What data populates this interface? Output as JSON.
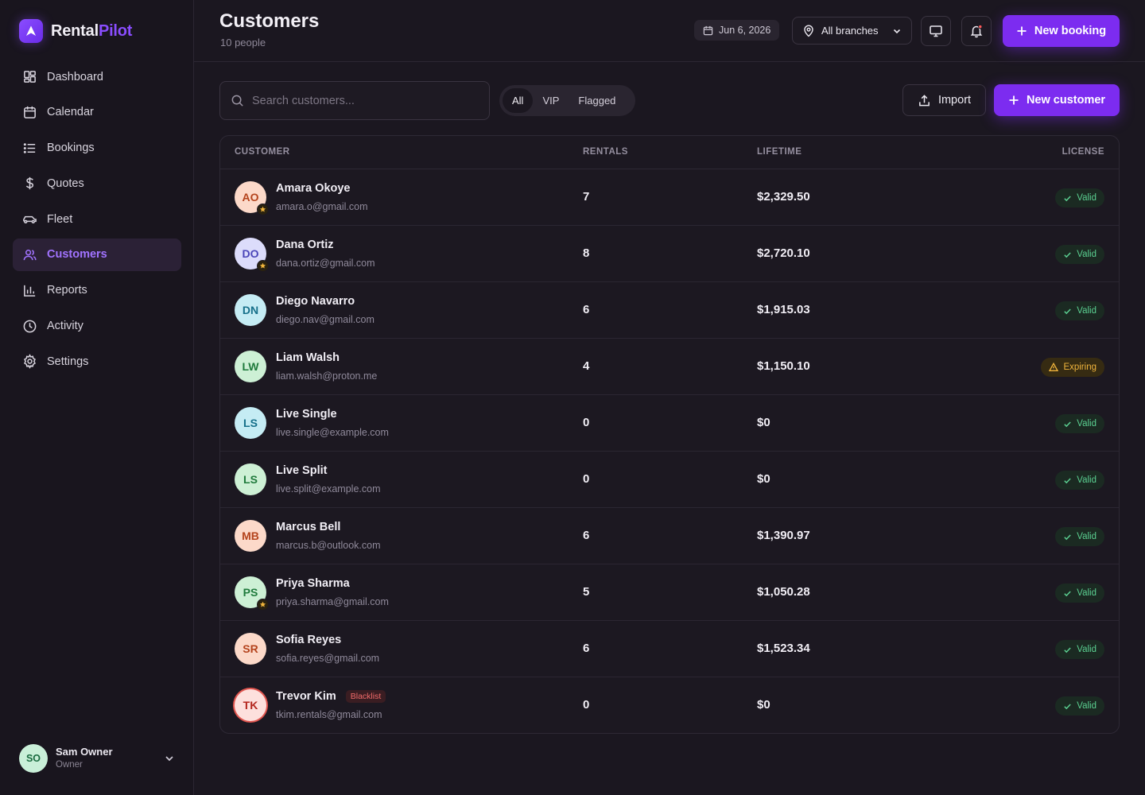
{
  "brand": {
    "name_a": "Rental",
    "name_b": "Pilot"
  },
  "sidebar": {
    "items": [
      {
        "key": "dashboard",
        "label": "Dashboard",
        "icon": "dashboard-icon"
      },
      {
        "key": "calendar",
        "label": "Calendar",
        "icon": "calendar-icon"
      },
      {
        "key": "bookings",
        "label": "Bookings",
        "icon": "list-icon"
      },
      {
        "key": "quotes",
        "label": "Quotes",
        "icon": "dollar-icon"
      },
      {
        "key": "fleet",
        "label": "Fleet",
        "icon": "car-icon"
      },
      {
        "key": "customers",
        "label": "Customers",
        "icon": "users-icon",
        "active": true
      },
      {
        "key": "reports",
        "label": "Reports",
        "icon": "bar-chart-icon"
      },
      {
        "key": "activity",
        "label": "Activity",
        "icon": "clock-icon"
      },
      {
        "key": "settings",
        "label": "Settings",
        "icon": "gear-icon"
      }
    ]
  },
  "user": {
    "initials": "SO",
    "name": "Sam Owner",
    "role": "Owner"
  },
  "header": {
    "title": "Customers",
    "subtitle": "10 people",
    "date": "Jun 6, 2026",
    "branch": "All branches",
    "new_booking": "New booking"
  },
  "toolbar": {
    "search_placeholder": "Search customers...",
    "filters": [
      "All",
      "VIP",
      "Flagged"
    ],
    "active_filter": "All",
    "import": "Import",
    "new_customer": "New customer"
  },
  "table": {
    "headers": {
      "customer": "CUSTOMER",
      "rentals": "RENTALS",
      "lifetime": "LIFETIME",
      "license": "LICENSE"
    },
    "rows": [
      {
        "initials": "AO",
        "name": "Amara Okoye",
        "email": "amara.o@gmail.com",
        "rentals": "7",
        "lifetime": "$2,329.50",
        "license": "Valid",
        "status": "valid",
        "vip": true,
        "avatar_bg": "#fcd9c9",
        "avatar_fg": "#b4431c"
      },
      {
        "initials": "DO",
        "name": "Dana Ortiz",
        "email": "dana.ortiz@gmail.com",
        "rentals": "8",
        "lifetime": "$2,720.10",
        "license": "Valid",
        "status": "valid",
        "vip": true,
        "avatar_bg": "#dcdcfb",
        "avatar_fg": "#4a45b8"
      },
      {
        "initials": "DN",
        "name": "Diego Navarro",
        "email": "diego.nav@gmail.com",
        "rentals": "6",
        "lifetime": "$1,915.03",
        "license": "Valid",
        "status": "valid",
        "avatar_bg": "#c5ecf4",
        "avatar_fg": "#16708a"
      },
      {
        "initials": "LW",
        "name": "Liam Walsh",
        "email": "liam.walsh@proton.me",
        "rentals": "4",
        "lifetime": "$1,150.10",
        "license": "Expiring",
        "status": "expiring",
        "avatar_bg": "#cdf0d5",
        "avatar_fg": "#1f7a3c"
      },
      {
        "initials": "LS",
        "name": "Live Single",
        "email": "live.single@example.com",
        "rentals": "0",
        "lifetime": "$0",
        "license": "Valid",
        "status": "valid",
        "avatar_bg": "#c5ecf4",
        "avatar_fg": "#16708a"
      },
      {
        "initials": "LS",
        "name": "Live Split",
        "email": "live.split@example.com",
        "rentals": "0",
        "lifetime": "$0",
        "license": "Valid",
        "status": "valid",
        "avatar_bg": "#cdf0d5",
        "avatar_fg": "#1f7a3c"
      },
      {
        "initials": "MB",
        "name": "Marcus Bell",
        "email": "marcus.b@outlook.com",
        "rentals": "6",
        "lifetime": "$1,390.97",
        "license": "Valid",
        "status": "valid",
        "avatar_bg": "#fcd9c9",
        "avatar_fg": "#b4431c"
      },
      {
        "initials": "PS",
        "name": "Priya Sharma",
        "email": "priya.sharma@gmail.com",
        "rentals": "5",
        "lifetime": "$1,050.28",
        "license": "Valid",
        "status": "valid",
        "vip": true,
        "avatar_bg": "#cdf0d5",
        "avatar_fg": "#1f7a3c"
      },
      {
        "initials": "SR",
        "name": "Sofia Reyes",
        "email": "sofia.reyes@gmail.com",
        "rentals": "6",
        "lifetime": "$1,523.34",
        "license": "Valid",
        "status": "valid",
        "avatar_bg": "#fcd9c9",
        "avatar_fg": "#b4431c"
      },
      {
        "initials": "TK",
        "name": "Trevor Kim",
        "email": "tkim.rentals@gmail.com",
        "rentals": "0",
        "lifetime": "$0",
        "license": "Valid",
        "status": "valid",
        "tag": "Blacklist",
        "avatar_bg": "#fde0dd",
        "avatar_fg": "#b3261e"
      }
    ]
  },
  "colors": {
    "accent": "#7c2cf0",
    "active_nav": "#a173ff",
    "valid": "#5bd091",
    "expiring": "#f0b43c",
    "blacklist": "#f06a6a"
  }
}
